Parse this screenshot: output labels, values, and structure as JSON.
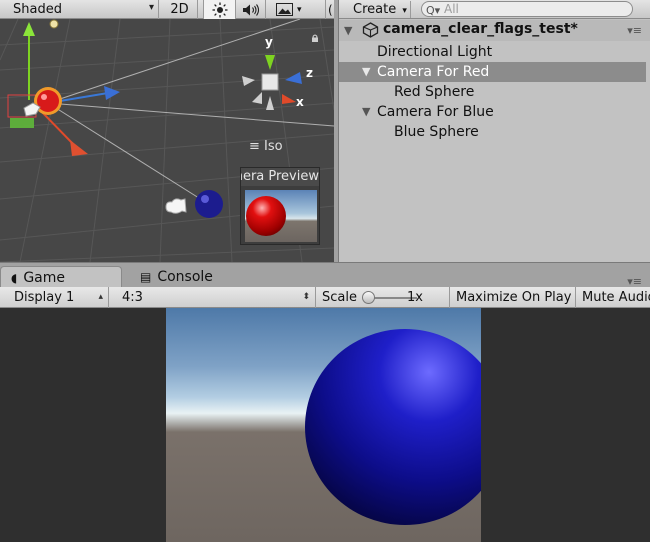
{
  "scene_view": {
    "shading_mode": "Shaded",
    "mode_2d_label": "2D",
    "projection_label": "Iso",
    "axis_x": "x",
    "axis_y": "y",
    "axis_z": "z",
    "camera_preview_title": "Camera Preview"
  },
  "hierarchy": {
    "create_label": "Create",
    "search_placeholder": "All",
    "scene_name": "camera_clear_flags_test*",
    "items": [
      {
        "label": "Directional Light",
        "depth": 0,
        "foldout": false,
        "selected": false
      },
      {
        "label": "Camera For Red",
        "depth": 0,
        "foldout": true,
        "selected": true
      },
      {
        "label": "Red Sphere",
        "depth": 1,
        "foldout": false,
        "selected": false
      },
      {
        "label": "Camera For Blue",
        "depth": 0,
        "foldout": true,
        "selected": false
      },
      {
        "label": "Blue Sphere",
        "depth": 1,
        "foldout": false,
        "selected": false
      }
    ]
  },
  "bottom_tabs": {
    "game_label": "Game",
    "console_label": "Console"
  },
  "game_toolbar": {
    "display": "Display 1",
    "aspect": "4:3",
    "scale_label": "Scale",
    "scale_value": "1x",
    "maximize_label": "Maximize On Play",
    "mute_label": "Mute Audio"
  },
  "colors": {
    "selection": "#8c8c8c",
    "panel": "#c2c2c2",
    "scene_bg": "#474747",
    "blue_sphere": "#1f1fc9",
    "red_sphere": "#e21010"
  }
}
